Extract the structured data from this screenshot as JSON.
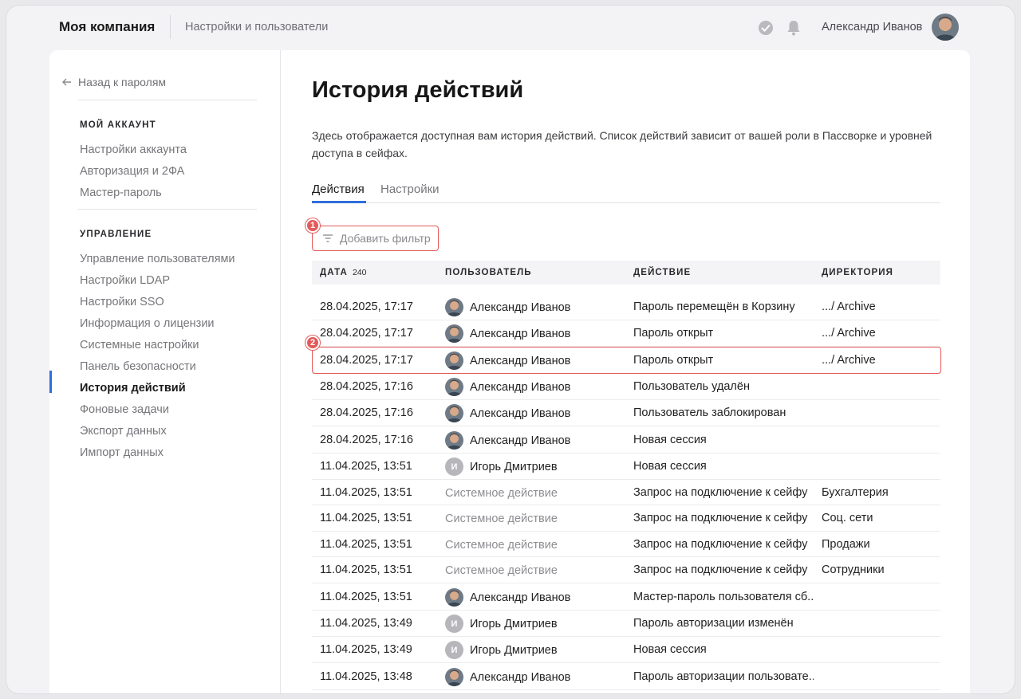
{
  "header": {
    "brand": "Моя компания",
    "crumb": "Настройки и пользователи",
    "user_name": "Александр Иванов",
    "icons": [
      "check-circle-icon",
      "bell-icon",
      "avatar"
    ]
  },
  "sidebar": {
    "back_label": "Назад к паролям",
    "sections": [
      {
        "title": "МОЙ АККАУНТ",
        "items": [
          "Настройки аккаунта",
          "Авторизация и 2ФА",
          "Мастер-пароль"
        ]
      },
      {
        "title": "УПРАВЛЕНИЕ",
        "items": [
          "Управление пользователями",
          "Настройки LDAP",
          "Настройки SSO",
          "Информация о лицензии",
          "Системные настройки",
          "Панель безопасности",
          "История действий",
          "Фоновые задачи",
          "Экспорт данных",
          "Импорт данных"
        ]
      }
    ],
    "active_item": "История действий",
    "accent_color": "#2f6fdb"
  },
  "main": {
    "title": "История действий",
    "description": "Здесь отображается доступная вам история действий. Список действий зависит от вашей роли в Пассворке и уровней доступа в сейфах.",
    "tabs": [
      {
        "label": "Действия",
        "active": true
      },
      {
        "label": "Настройки",
        "active": false
      }
    ],
    "filter_label": "Добавить фильтр",
    "markers": [
      "1",
      "2"
    ],
    "highlight_color": "#e45a5a"
  },
  "table": {
    "columns": {
      "date": "ДАТА",
      "date_count": "240",
      "user": "ПОЛЬЗОВАТЕЛЬ",
      "action": "ДЕЙСТВИЕ",
      "directory": "ДИРЕКТОРИЯ"
    },
    "rows": [
      {
        "date": "28.04.2025, 17:17",
        "user": "Александр Иванов",
        "avatar": "photo",
        "action": "Пароль перемещён в Корзину",
        "dir": ".../ Archive"
      },
      {
        "date": "28.04.2025, 17:17",
        "user": "Александр Иванов",
        "avatar": "photo",
        "action": "Пароль открыт",
        "dir": ".../ Archive"
      },
      {
        "date": "28.04.2025, 17:17",
        "user": "Александр Иванов",
        "avatar": "photo",
        "action": "Пароль открыт",
        "dir": ".../ Archive"
      },
      {
        "date": "28.04.2025, 17:16",
        "user": "Александр Иванов",
        "avatar": "photo",
        "action": "Пользователь удалён",
        "dir": ""
      },
      {
        "date": "28.04.2025, 17:16",
        "user": "Александр Иванов",
        "avatar": "photo",
        "action": "Пользователь заблокирован",
        "dir": ""
      },
      {
        "date": "28.04.2025, 17:16",
        "user": "Александр Иванов",
        "avatar": "photo",
        "action": "Новая сессия",
        "dir": ""
      },
      {
        "date": "11.04.2025, 13:51",
        "user": "Игорь Дмитриев",
        "avatar": "И",
        "action": "Новая сессия",
        "dir": ""
      },
      {
        "date": "11.04.2025, 13:51",
        "user": "Системное действие",
        "avatar": "none",
        "action": "Запрос на подключение к сейфу",
        "dir": "Бухгалтерия"
      },
      {
        "date": "11.04.2025, 13:51",
        "user": "Системное действие",
        "avatar": "none",
        "action": "Запрос на подключение к сейфу",
        "dir": "Соц. сети"
      },
      {
        "date": "11.04.2025, 13:51",
        "user": "Системное действие",
        "avatar": "none",
        "action": "Запрос на подключение к сейфу",
        "dir": "Продажи"
      },
      {
        "date": "11.04.2025, 13:51",
        "user": "Системное действие",
        "avatar": "none",
        "action": "Запрос на подключение к сейфу",
        "dir": "Сотрудники"
      },
      {
        "date": "11.04.2025, 13:51",
        "user": "Александр Иванов",
        "avatar": "photo",
        "action": "Мастер-пароль пользователя сб...",
        "dir": ""
      },
      {
        "date": "11.04.2025, 13:49",
        "user": "Игорь Дмитриев",
        "avatar": "И",
        "action": "Пароль авторизации изменён",
        "dir": ""
      },
      {
        "date": "11.04.2025, 13:49",
        "user": "Игорь Дмитриев",
        "avatar": "И",
        "action": "Новая сессия",
        "dir": ""
      },
      {
        "date": "11.04.2025, 13:48",
        "user": "Александр Иванов",
        "avatar": "photo",
        "action": "Пароль авторизации пользовате...",
        "dir": ""
      }
    ]
  }
}
